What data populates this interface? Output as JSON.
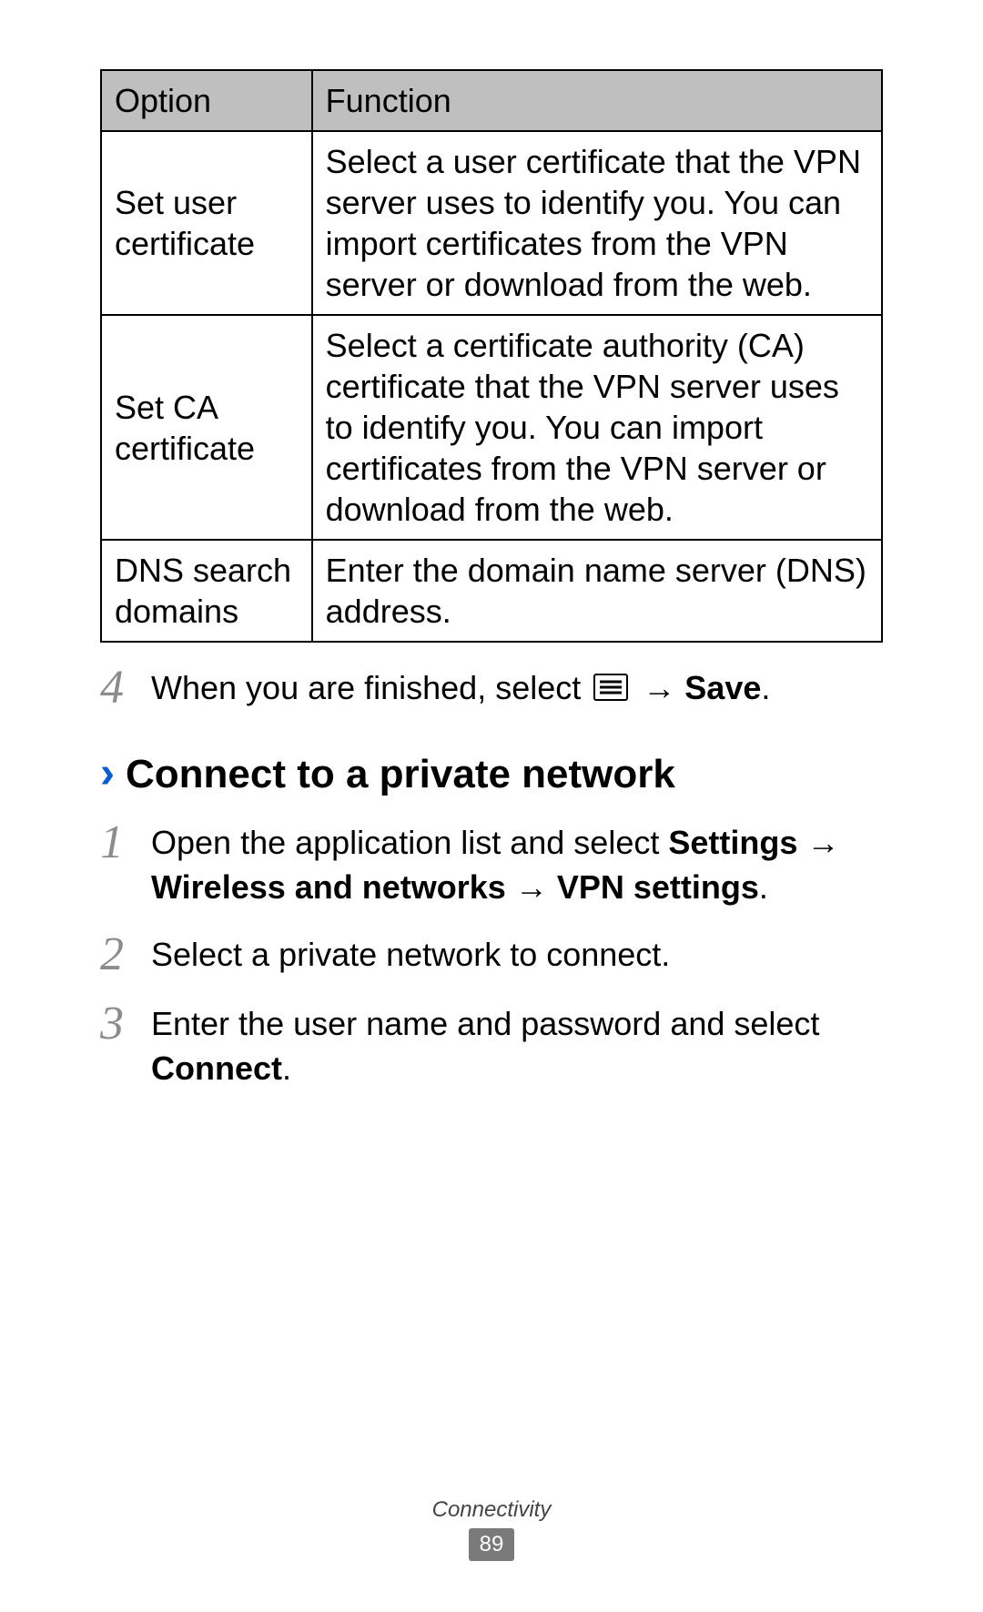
{
  "table": {
    "headers": {
      "option": "Option",
      "function": "Function"
    },
    "rows": [
      {
        "option": "Set user certificate",
        "function": "Select a user certificate that the VPN server uses to identify you. You can import certificates from the VPN server or download from the web."
      },
      {
        "option": "Set CA certificate",
        "function": "Select a certificate authority (CA) certificate that the VPN server uses to identify you. You can import certificates from the VPN server or download from the web."
      },
      {
        "option": "DNS search domains",
        "function": "Enter the domain name server (DNS) address."
      }
    ]
  },
  "step4": {
    "num": "4",
    "pre": "When you are finished, select ",
    "arrow": " → ",
    "save": "Save",
    "post": "."
  },
  "section": {
    "chevron": "›",
    "title": "Connect to a private network"
  },
  "steps": {
    "s1": {
      "num": "1",
      "pre": "Open the application list and select ",
      "b1": "Settings",
      "a1": " → ",
      "b2": "Wireless and networks",
      "a2": " → ",
      "b3": "VPN settings",
      "post": "."
    },
    "s2": {
      "num": "2",
      "text": "Select a private network to connect."
    },
    "s3": {
      "num": "3",
      "pre": "Enter the user name and password and select ",
      "b1": "Connect",
      "post": "."
    }
  },
  "footer": {
    "section": "Connectivity",
    "page": "89"
  }
}
